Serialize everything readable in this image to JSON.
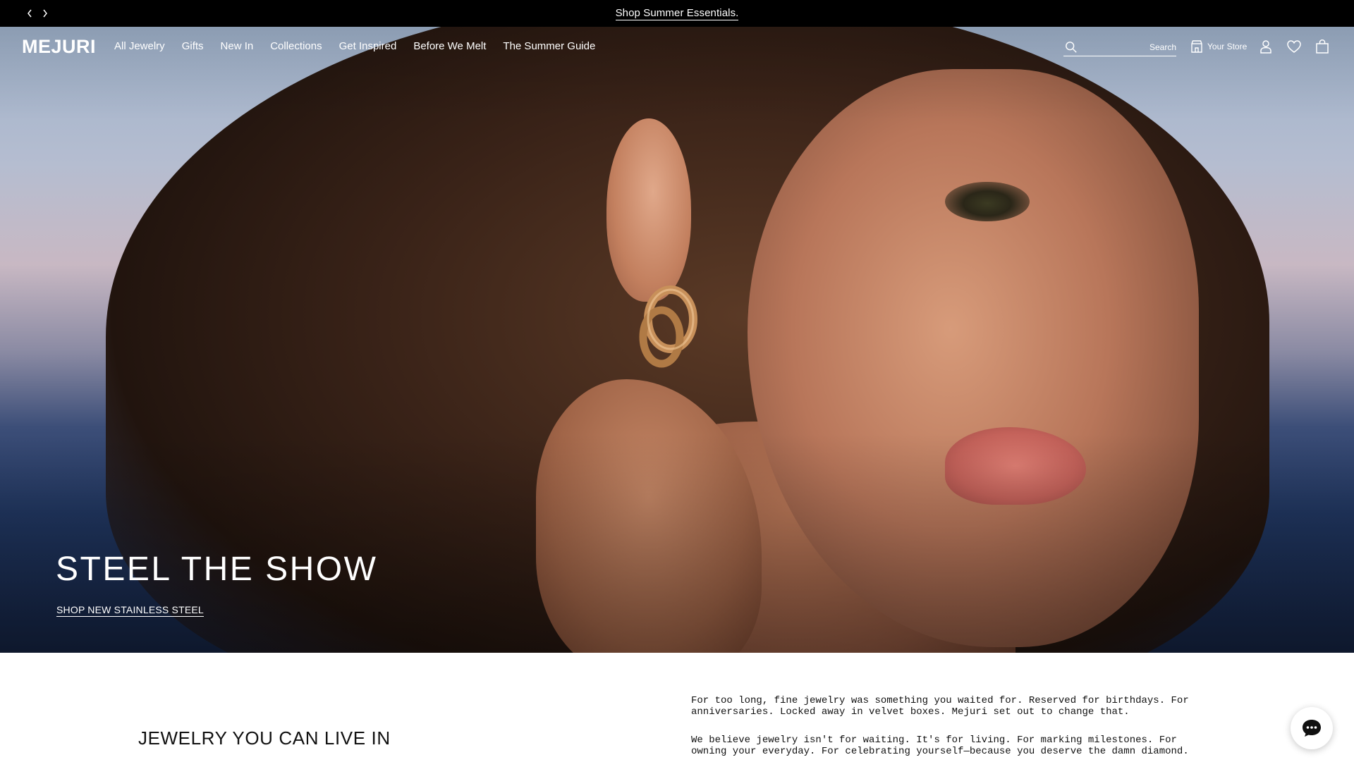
{
  "announcement": {
    "text": "Shop Summer Essentials.",
    "prev_icon": "chevron-left-icon",
    "next_icon": "chevron-right-icon"
  },
  "header": {
    "logo": "MEJURI",
    "nav": [
      {
        "label": "All Jewelry"
      },
      {
        "label": "Gifts"
      },
      {
        "label": "New In"
      },
      {
        "label": "Collections"
      },
      {
        "label": "Get Inspired"
      },
      {
        "label": "Before We Melt"
      },
      {
        "label": "The Summer Guide"
      }
    ],
    "search": {
      "placeholder": "",
      "label": "Search",
      "icon": "search-icon"
    },
    "store": {
      "label": "Your Store",
      "icon": "store-icon"
    },
    "icons": [
      "account-icon",
      "wishlist-heart-icon",
      "shopping-bag-icon"
    ]
  },
  "hero": {
    "title": "STEEL THE SHOW",
    "cta": "SHOP NEW STAINLESS STEEL"
  },
  "section": {
    "title": "JEWELRY YOU CAN LIVE IN",
    "paragraphs": [
      "For too long, fine jewelry was something you waited for. Reserved for birthdays. For anniversaries. Locked away in velvet boxes. Mejuri set out to change that.",
      "We believe jewelry isn't for waiting. It's for living. For marking milestones. For owning your everyday. For celebrating yourself—because you deserve the damn diamond."
    ]
  },
  "chat": {
    "icon": "chat-bubble-icon"
  },
  "colors": {
    "announcement_bg": "#000000",
    "text_light": "#ffffff",
    "text_dark": "#111111"
  }
}
